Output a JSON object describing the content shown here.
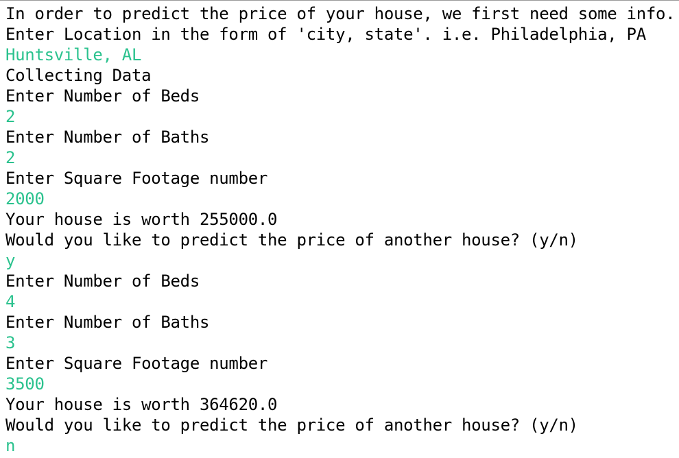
{
  "colors": {
    "output": "#000000",
    "input": "#2bc28e",
    "background": "#ffffff"
  },
  "console": {
    "lines": [
      {
        "kind": "output",
        "text": "In order to predict the price of your house, we first need some info."
      },
      {
        "kind": "output",
        "text": "Enter Location in the form of 'city, state'. i.e. Philadelphia, PA"
      },
      {
        "kind": "input",
        "text": "Huntsville, AL"
      },
      {
        "kind": "output",
        "text": "Collecting Data"
      },
      {
        "kind": "output",
        "text": "Enter Number of Beds"
      },
      {
        "kind": "input",
        "text": "2"
      },
      {
        "kind": "output",
        "text": "Enter Number of Baths"
      },
      {
        "kind": "input",
        "text": "2"
      },
      {
        "kind": "output",
        "text": "Enter Square Footage number"
      },
      {
        "kind": "input",
        "text": "2000"
      },
      {
        "kind": "output",
        "text": "Your house is worth 255000.0"
      },
      {
        "kind": "output",
        "text": "Would you like to predict the price of another house? (y/n)"
      },
      {
        "kind": "input",
        "text": "y"
      },
      {
        "kind": "output",
        "text": "Enter Number of Beds"
      },
      {
        "kind": "input",
        "text": "4"
      },
      {
        "kind": "output",
        "text": "Enter Number of Baths"
      },
      {
        "kind": "input",
        "text": "3"
      },
      {
        "kind": "output",
        "text": "Enter Square Footage number"
      },
      {
        "kind": "input",
        "text": "3500"
      },
      {
        "kind": "output",
        "text": "Your house is worth 364620.0"
      },
      {
        "kind": "output",
        "text": "Would you like to predict the price of another house? (y/n)"
      },
      {
        "kind": "input",
        "text": "n"
      }
    ]
  }
}
